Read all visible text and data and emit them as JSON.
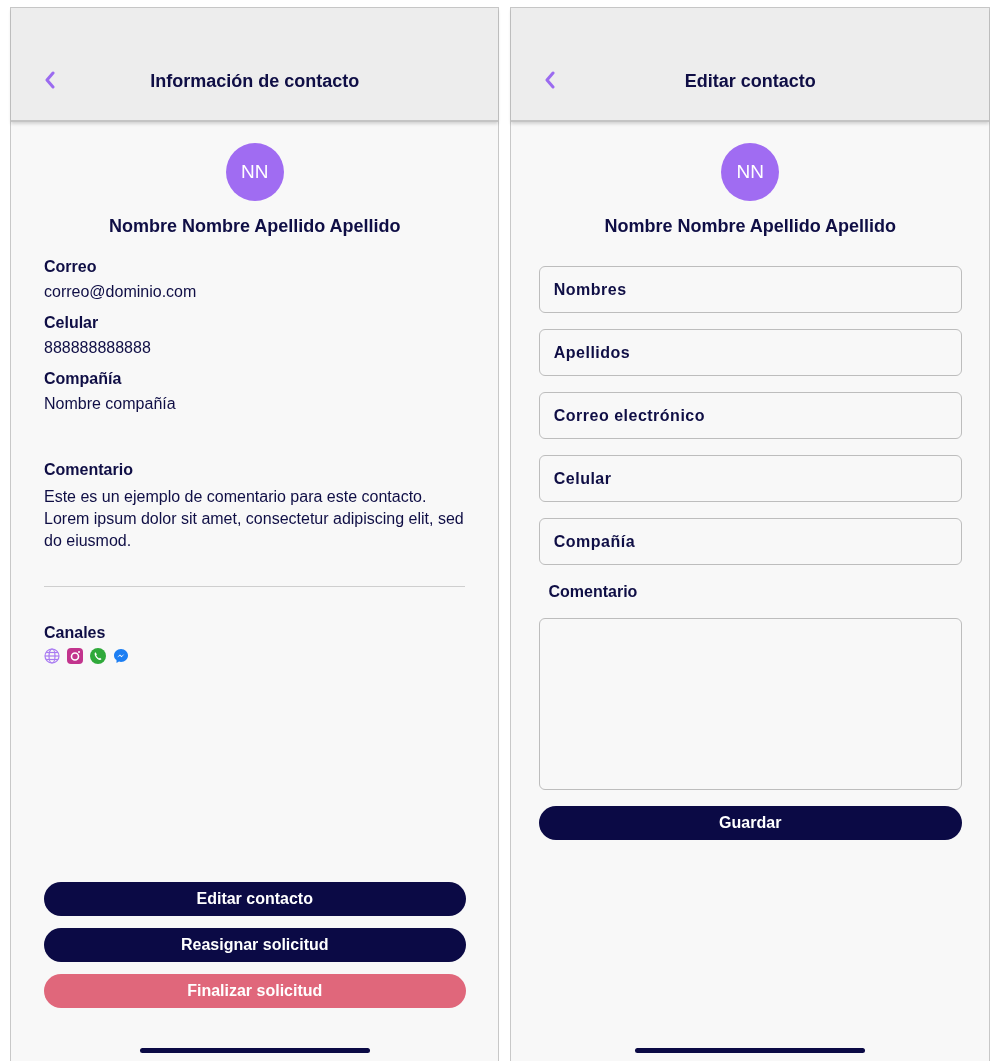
{
  "info_screen": {
    "title": "Información de contacto",
    "contact": {
      "initials": "NN",
      "name": "Nombre Nombre Apellido Apellido"
    },
    "fields": [
      {
        "label": "Correo",
        "value": "correo@dominio.com"
      },
      {
        "label": "Celular",
        "value": "888888888888"
      },
      {
        "label": "Compañía",
        "value": "Nombre compañía"
      }
    ],
    "comment": {
      "label": "Comentario",
      "text": "Este es un ejemplo de comentario para este contacto. Lorem ipsum dolor sit amet, consectetur adipiscing elit, sed do eiusmod."
    },
    "channels": {
      "label": "Canales",
      "items": [
        {
          "kind": "web"
        },
        {
          "kind": "instagram"
        },
        {
          "kind": "whatsapp"
        },
        {
          "kind": "messenger"
        }
      ]
    },
    "buttons": [
      {
        "label": "Editar contacto",
        "kind": "primary"
      },
      {
        "label": "Reasignar solicitud",
        "kind": "primary"
      },
      {
        "label": "Finalizar solicitud",
        "kind": "danger"
      }
    ]
  },
  "edit_screen": {
    "title": "Editar contacto",
    "contact": {
      "initials": "NN",
      "name": "Nombre Nombre Apellido Apellido"
    },
    "inputs": [
      {
        "placeholder": "Nombres"
      },
      {
        "placeholder": "Apellidos"
      },
      {
        "placeholder": "Correo electrónico"
      },
      {
        "placeholder": "Celular"
      },
      {
        "placeholder": "Compañía"
      }
    ],
    "comment_label": "Comentario",
    "save_button": "Guardar"
  }
}
